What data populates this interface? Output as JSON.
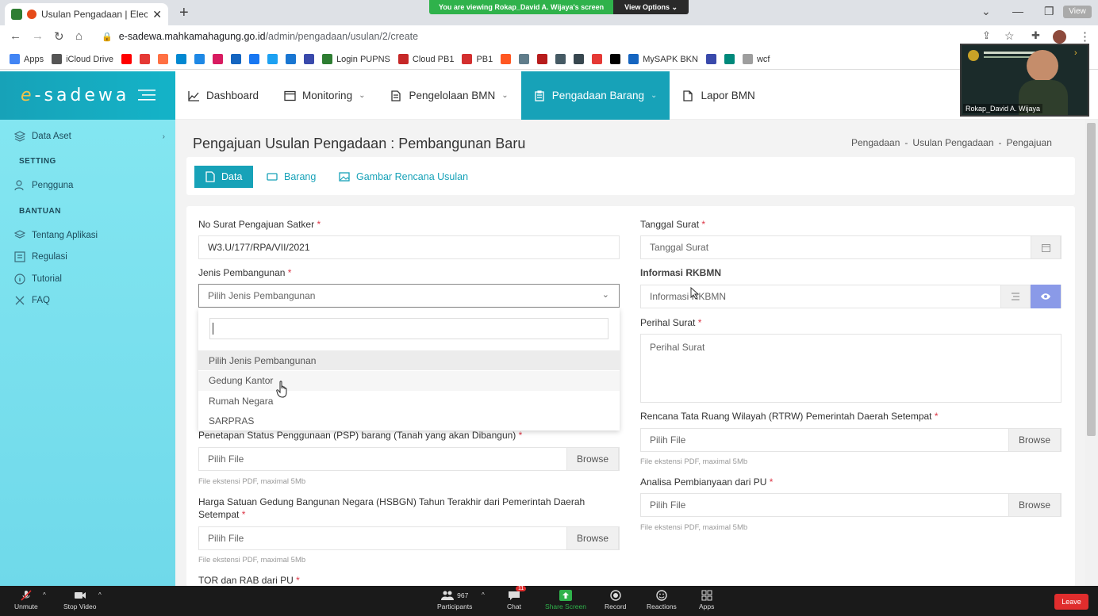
{
  "browser": {
    "tab_title": "Usulan Pengadaan | Electronic St",
    "banner_text": "You are viewing Rokap_David A. Wijaya's screen",
    "banner_options": "View Options",
    "view_button": "View",
    "url_host": "e-sadewa.mahkamahagung.go.id",
    "url_path": "/admin/pengadaan/usulan/2/create"
  },
  "bookmarks": [
    {
      "label": "Apps",
      "color": "#4285f4"
    },
    {
      "label": "iCloud Drive",
      "color": "#555555"
    },
    {
      "label": "",
      "color": "#ff0000"
    },
    {
      "label": "",
      "color": "#e53935"
    },
    {
      "label": "",
      "color": "#ff7043"
    },
    {
      "label": "",
      "color": "#0288d1"
    },
    {
      "label": "",
      "color": "#1e88e5"
    },
    {
      "label": "",
      "color": "#d81b60"
    },
    {
      "label": "",
      "color": "#1565c0"
    },
    {
      "label": "",
      "color": "#1877f2"
    },
    {
      "label": "",
      "color": "#1da1f2"
    },
    {
      "label": "",
      "color": "#1976d2"
    },
    {
      "label": "",
      "color": "#3949ab"
    },
    {
      "label": "Login PUPNS",
      "color": "#2e7d32"
    },
    {
      "label": "Cloud PB1",
      "color": "#c62828"
    },
    {
      "label": "PB1",
      "color": "#d32f2f"
    },
    {
      "label": "",
      "color": "#ff5722"
    },
    {
      "label": "",
      "color": "#607d8b"
    },
    {
      "label": "",
      "color": "#b71c1c"
    },
    {
      "label": "",
      "color": "#455a64"
    },
    {
      "label": "",
      "color": "#37474f"
    },
    {
      "label": "",
      "color": "#e53935"
    },
    {
      "label": "",
      "color": "#000000"
    },
    {
      "label": "MySAPK BKN",
      "color": "#1565c0"
    },
    {
      "label": "",
      "color": "#3949ab"
    },
    {
      "label": "",
      "color": "#00897b"
    },
    {
      "label": "wcf",
      "color": "#9e9e9e"
    }
  ],
  "brand": {
    "logo_prefix": "e",
    "logo_rest": "-sadewa"
  },
  "menu": [
    {
      "label": "Dashboard",
      "icon": "chart-icon",
      "dropdown": false,
      "active": false
    },
    {
      "label": "Monitoring",
      "icon": "window-icon",
      "dropdown": true,
      "active": false
    },
    {
      "label": "Pengelolaan BMN",
      "icon": "document-icon",
      "dropdown": true,
      "active": false
    },
    {
      "label": "Pengadaan Barang",
      "icon": "clipboard-icon",
      "dropdown": true,
      "active": true
    },
    {
      "label": "Lapor BMN",
      "icon": "file-icon",
      "dropdown": false,
      "active": false
    }
  ],
  "sidebar": {
    "data_aset": "Data Aset",
    "setting_heading": "SETTING",
    "pengguna": "Pengguna",
    "bantuan_heading": "BANTUAN",
    "tentang": "Tentang Aplikasi",
    "regulasi": "Regulasi",
    "tutorial": "Tutorial",
    "faq": "FAQ"
  },
  "page": {
    "title": "Pengajuan Usulan Pengadaan : Pembangunan Baru",
    "breadcrumb": [
      "Pengadaan",
      "Usulan Pengadaan",
      "Pengajuan"
    ]
  },
  "tabs": {
    "data": "Data",
    "barang": "Barang",
    "gambar": "Gambar Rencana Usulan"
  },
  "form": {
    "no_surat_label": "No Surat Pengajuan Satker",
    "no_surat_value": "W3.U/177/RPA/VII/2021",
    "jenis_label": "Jenis Pembangunan",
    "jenis_placeholder": "Pilih Jenis Pembangunan",
    "psp_label": "Penetapan Status Penggunaan (PSP) barang (Tanah yang akan Dibangun)",
    "hsbgn_label_1": "Harga Satuan Gedung Bangunan Negara (HSBGN) Tahun Terakhir dari Pemerintah Daerah",
    "hsbgn_label_2": "Setempat",
    "tor_label": "TOR dan RAB dari PU",
    "tanggal_label": "Tanggal Surat",
    "tanggal_placeholder": "Tanggal Surat",
    "rkbmn_label": "Informasi RKBMN",
    "rkbmn_placeholder": "Informasi RKBMN",
    "perihal_label": "Perihal Surat",
    "perihal_placeholder": "Perihal Surat",
    "rtrw_label": "Rencana Tata Ruang Wilayah (RTRW) Pemerintah Daerah Setempat",
    "analisa_label": "Analisa Pembianyaan dari PU",
    "file_placeholder": "Pilih File",
    "browse": "Browse",
    "file_hint": "File ekstensi PDF, maximal 5Mb",
    "required_mark": "*"
  },
  "dropdown": {
    "options": [
      "Pilih Jenis Pembangunan",
      "Gedung Kantor",
      "Rumah Negara",
      "SARPRAS"
    ],
    "highlighted_index": 0,
    "hover_index": 1
  },
  "video": {
    "name": "Rokap_David A. Wijaya"
  },
  "zoom": {
    "unmute": "Unmute",
    "stop_video": "Stop Video",
    "participants": "Participants",
    "participants_count": "967",
    "chat": "Chat",
    "chat_badge": "11",
    "share": "Share Screen",
    "record": "Record",
    "reactions": "Reactions",
    "apps": "Apps",
    "leave": "Leave"
  },
  "colors": {
    "accent": "#17a2b8",
    "required": "#dc3545",
    "share_green": "#2fb24b",
    "leave_red": "#e02d2d"
  }
}
